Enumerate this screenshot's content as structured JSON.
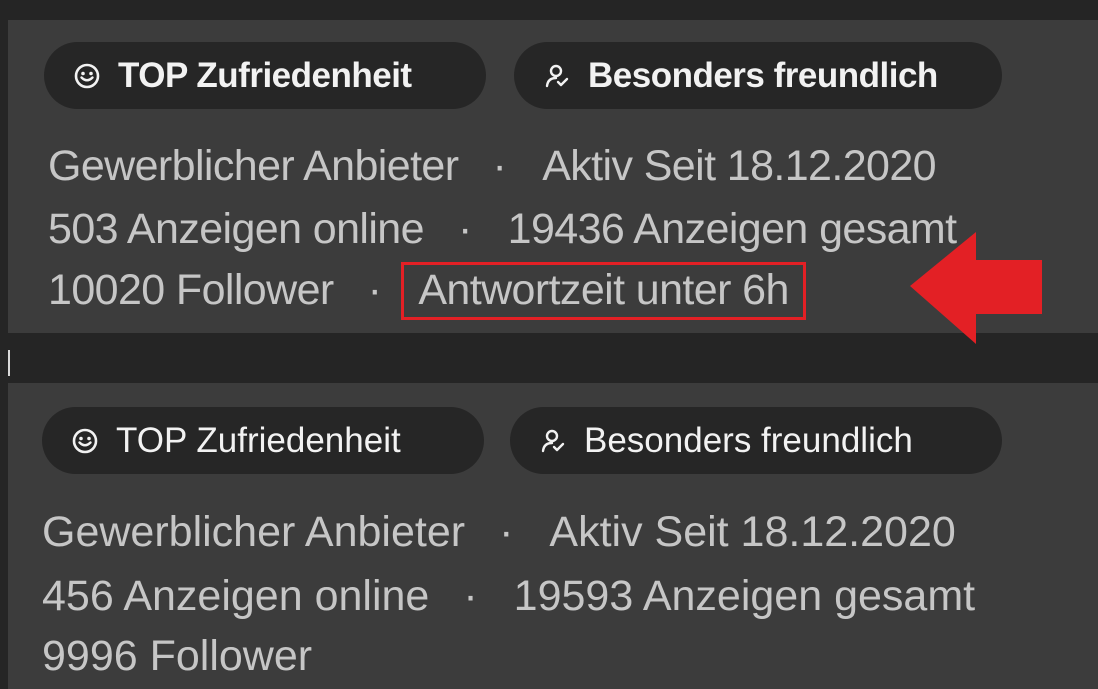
{
  "top": {
    "badges": [
      {
        "label": "TOP Zufriedenheit",
        "icon": "smiley-icon"
      },
      {
        "label": "Besonders freundlich",
        "icon": "friendly-person-icon"
      }
    ],
    "line1": {
      "type": "Gewerblicher Anbieter",
      "separator": "·",
      "since": "Aktiv Seit 18.12.2020"
    },
    "line2": {
      "online": "503 Anzeigen online",
      "separator": "·",
      "total": "19436 Anzeigen gesamt"
    },
    "line3": {
      "followers": "10020 Follower",
      "separator": "·",
      "response_time": "Antwortzeit unter 6h"
    }
  },
  "bottom": {
    "badges": [
      {
        "label": "TOP Zufriedenheit",
        "icon": "smiley-icon"
      },
      {
        "label": "Besonders freundlich",
        "icon": "friendly-person-icon"
      }
    ],
    "line1": {
      "type": "Gewerblicher Anbieter",
      "separator": "·",
      "since": "Aktiv Seit 18.12.2020"
    },
    "line2": {
      "online": "456 Anzeigen online",
      "separator": "·",
      "total": "19593 Anzeigen gesamt"
    },
    "line3": {
      "followers": "9996 Follower"
    }
  },
  "annotation": {
    "highlight_color": "#e32025",
    "arrow_icon": "red-arrow-left-icon"
  }
}
